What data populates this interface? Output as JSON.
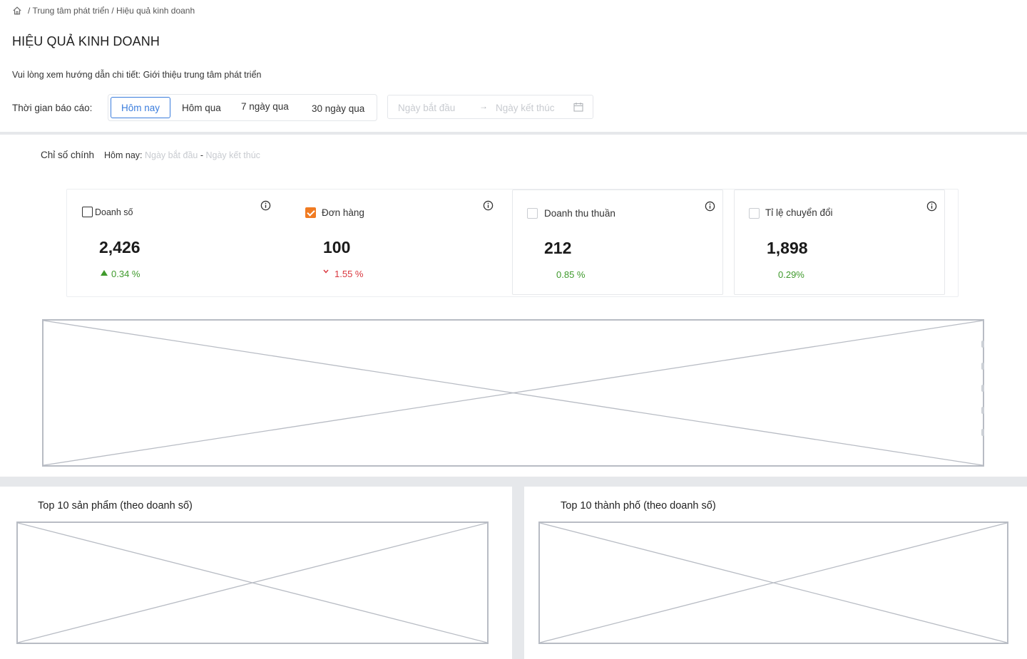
{
  "breadcrumb": {
    "icon": "home-icon",
    "text": "/ Trung tâm phát triển / Hiệu quả kinh doanh"
  },
  "page": {
    "title": "HIỆU QUẢ KINH DOANH",
    "guide": "Vui lòng xem hướng dẫn chi tiết: Giới thiệu trung tâm phát triển"
  },
  "report_time": {
    "label": "Thời gian báo cáo:",
    "periods": [
      "Hôm nay",
      "Hôm qua",
      "7 ngày qua",
      "30 ngày qua"
    ],
    "active_period": "Hôm nay",
    "start_placeholder": "Ngày bắt đầu",
    "end_placeholder": "Ngày kết thúc",
    "arrow": "→",
    "calendar_icon": "calendar-icon"
  },
  "metrics": {
    "title": "Chỉ số chính",
    "period_label": "Hôm nay:",
    "start": "Ngày bắt đầu",
    "separator": "-",
    "end": "Ngày kết thúc",
    "cards": [
      {
        "label": "Doanh số",
        "value": "2,426",
        "change": "0.34 %",
        "trend": "up",
        "checked": false
      },
      {
        "label": "Đơn hàng",
        "value": "100",
        "change": "1.55 %",
        "trend": "down",
        "checked": true
      },
      {
        "label": "Doanh thu thuần",
        "value": "212",
        "change": "0.85 %",
        "trend": "neutral",
        "checked": false
      },
      {
        "label": "Tỉ lệ chuyển đổi",
        "value": "1,898",
        "change": "0.29%",
        "trend": "neutral",
        "checked": false
      }
    ],
    "colors": {
      "up": "#3f9a2c",
      "down": "#d9363e",
      "checked": "#f07b22",
      "active": "#3b7ddd"
    }
  },
  "panels": {
    "top_products": "Top 10 sản phẩm (theo doanh số)",
    "top_cities": "Top 10 thành phố (theo doanh số)"
  }
}
